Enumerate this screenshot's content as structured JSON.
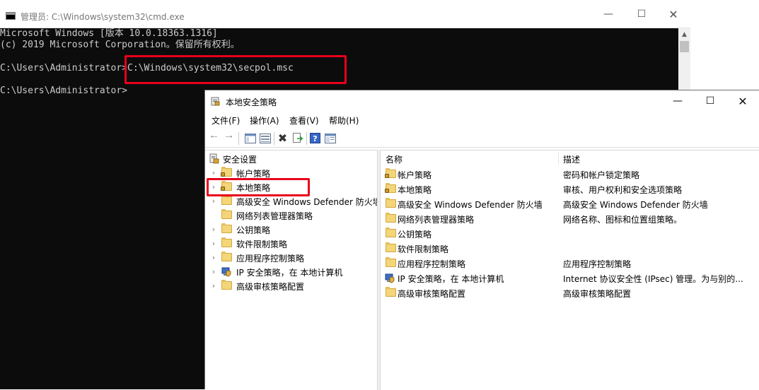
{
  "cmd": {
    "title": "管理员: C:\\Windows\\system32\\cmd.exe",
    "lines": [
      "Microsoft Windows [版本 10.0.18363.1316]",
      "(c) 2019 Microsoft Corporation。保留所有权利。",
      "",
      "C:\\Users\\Administrator>C:\\Windows\\system32\\secpol.msc",
      "",
      "C:\\Users\\Administrator>"
    ]
  },
  "mmc": {
    "title": "本地安全策略",
    "menu": [
      "文件(F)",
      "操作(A)",
      "查看(V)",
      "帮助(H)"
    ],
    "tree": {
      "root": "安全设置",
      "items": [
        "帐户策略",
        "本地策略",
        "高级安全 Windows Defender 防火墙",
        "网络列表管理器策略",
        "公钥策略",
        "软件限制策略",
        "应用程序控制策略",
        "IP 安全策略，在 本地计算机",
        "高级审核策略配置"
      ]
    },
    "list": {
      "col_name": "名称",
      "col_desc": "描述",
      "rows": [
        {
          "name": "帐户策略",
          "desc": "密码和帐户锁定策略"
        },
        {
          "name": "本地策略",
          "desc": "审核、用户权利和安全选项策略"
        },
        {
          "name": "高级安全 Windows Defender 防火墙",
          "desc": "高级安全 Windows Defender 防火墙"
        },
        {
          "name": "网络列表管理器策略",
          "desc": "网络名称、图标和位置组策略。"
        },
        {
          "name": "公钥策略",
          "desc": ""
        },
        {
          "name": "软件限制策略",
          "desc": ""
        },
        {
          "name": "应用程序控制策略",
          "desc": "应用程序控制策略"
        },
        {
          "name": "IP 安全策略，在 本地计算机",
          "desc": "Internet 协议安全性 (IPsec) 管理。为与别的..."
        },
        {
          "name": "高级审核策略配置",
          "desc": "高级审核策略配置"
        }
      ]
    }
  }
}
